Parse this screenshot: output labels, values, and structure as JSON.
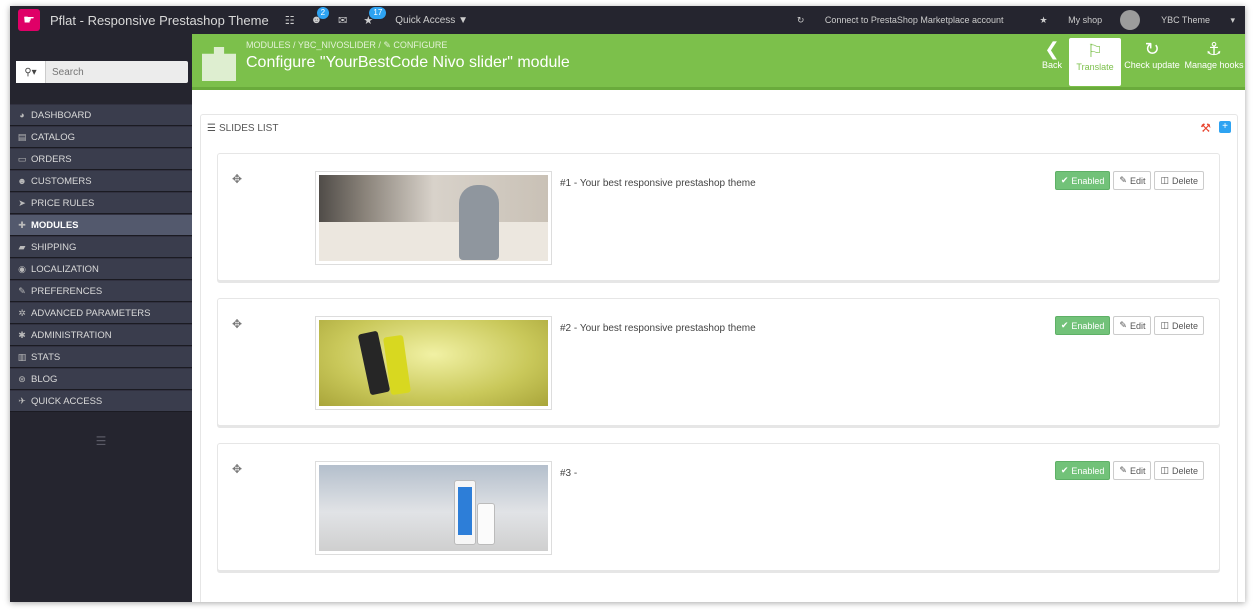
{
  "topbar": {
    "app_title": "Pflat - Responsive Prestashop Theme",
    "cart_icon": "cart-icon",
    "customers_badge": "2",
    "messages_icon": "envelope-icon",
    "orders_badge": "17",
    "quick_access": "Quick Access",
    "marketplace": "Connect to PrestaShop Marketplace account",
    "my_shop": "My shop",
    "user": "YBC Theme"
  },
  "sidebar": {
    "search_placeholder": "Search",
    "items": [
      {
        "label": "DASHBOARD",
        "icon": "dashboard-icon",
        "glyph": "◕",
        "active": false
      },
      {
        "label": "CATALOG",
        "icon": "book-icon",
        "glyph": "▤",
        "active": false
      },
      {
        "label": "ORDERS",
        "icon": "credit-card-icon",
        "glyph": "▭",
        "active": false
      },
      {
        "label": "CUSTOMERS",
        "icon": "users-icon",
        "glyph": "☻",
        "active": false
      },
      {
        "label": "PRICE RULES",
        "icon": "tags-icon",
        "glyph": "➤",
        "active": false
      },
      {
        "label": "MODULES",
        "icon": "puzzle-icon",
        "glyph": "✚",
        "active": true
      },
      {
        "label": "SHIPPING",
        "icon": "truck-icon",
        "glyph": "▰",
        "active": false
      },
      {
        "label": "LOCALIZATION",
        "icon": "globe-icon",
        "glyph": "◉",
        "active": false
      },
      {
        "label": "PREFERENCES",
        "icon": "wrench-icon",
        "glyph": "✎",
        "active": false
      },
      {
        "label": "ADVANCED PARAMETERS",
        "icon": "cogs-icon",
        "glyph": "✲",
        "active": false
      },
      {
        "label": "ADMINISTRATION",
        "icon": "cog-icon",
        "glyph": "✱",
        "active": false
      },
      {
        "label": "STATS",
        "icon": "bar-chart-icon",
        "glyph": "▥",
        "active": false
      },
      {
        "label": "BLOG",
        "icon": "wordpress-icon",
        "glyph": "⊛",
        "active": false
      },
      {
        "label": "QUICK ACCESS",
        "icon": "link-icon",
        "glyph": "✈",
        "active": false
      }
    ]
  },
  "header": {
    "breadcrumb": "MODULES  /  YBC_NIVOSLIDER  /  ✎ CONFIGURE",
    "title": "Configure \"YourBestCode Nivo slider\" module",
    "toolbar": {
      "back": "Back",
      "translate": "Translate",
      "check_update": "Check update",
      "manage_hooks": "Manage hooks"
    }
  },
  "panel": {
    "heading": "SLIDES LIST",
    "slides": [
      {
        "title": "#1 - Your best responsive prestashop theme",
        "status": "Enabled",
        "edit": "Edit",
        "delete": "Delete"
      },
      {
        "title": "#2 - Your best responsive prestashop theme",
        "status": "Enabled",
        "edit": "Edit",
        "delete": "Delete"
      },
      {
        "title": "#3 -",
        "status": "Enabled",
        "edit": "Edit",
        "delete": "Delete"
      }
    ]
  },
  "colors": {
    "header_green": "#7cc04b",
    "sidebar_dark": "#25252f",
    "enabled_green": "#72c279",
    "badge_blue": "#2ea3f2",
    "wrench_red": "#e8442e"
  }
}
